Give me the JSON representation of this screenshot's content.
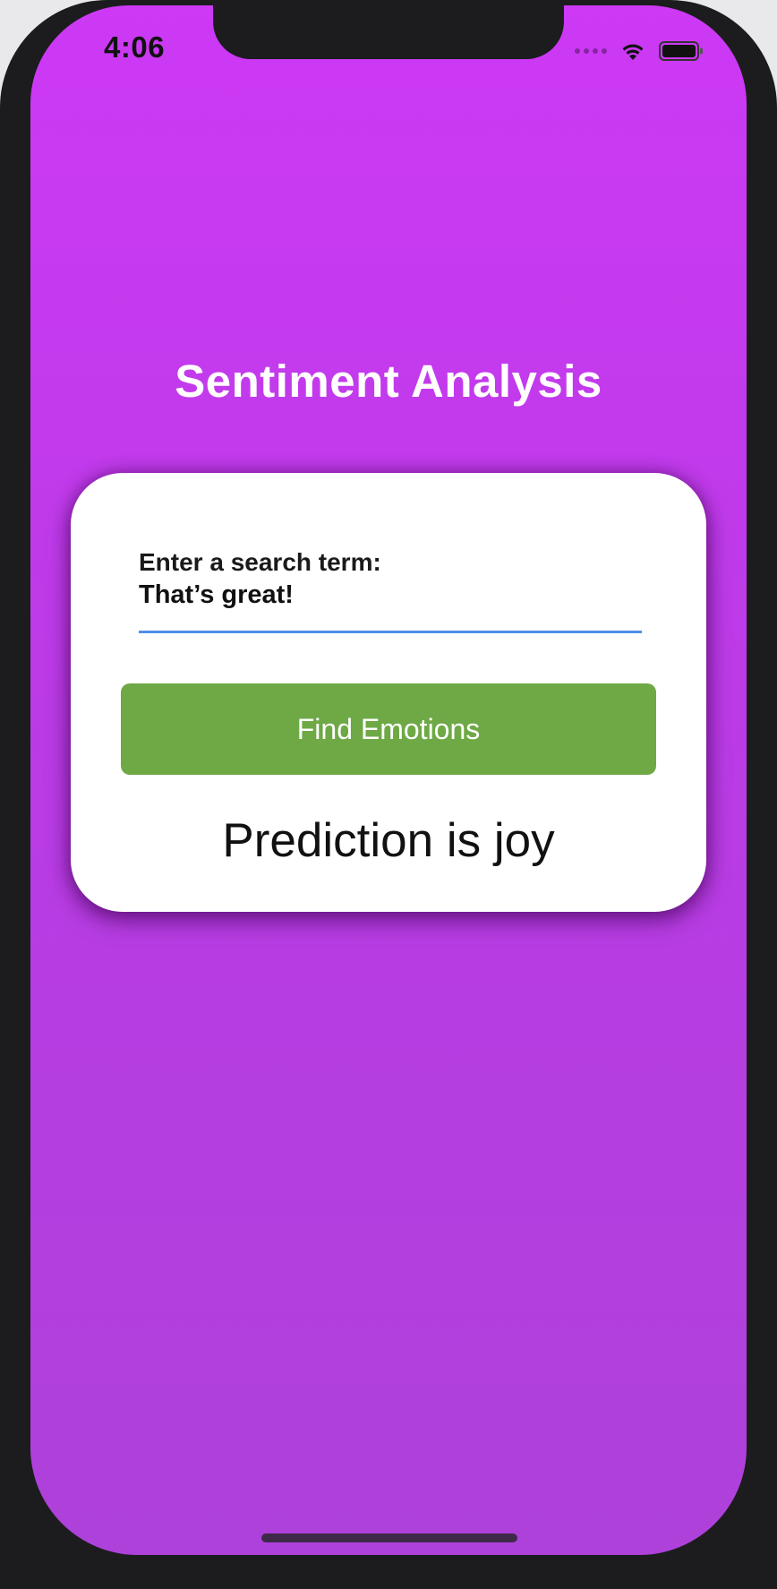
{
  "status_bar": {
    "time": "4:06",
    "icons": [
      "signal-dots-icon",
      "wifi-icon",
      "battery-icon"
    ]
  },
  "app": {
    "title": "Sentiment Analysis"
  },
  "card": {
    "field_label": "Enter a search term:",
    "field_value": "That’s great!",
    "button_label": "Find Emotions",
    "prediction_text": "Prediction is joy"
  },
  "colors": {
    "background_top": "#cd39f5",
    "background_bottom": "#ae41da",
    "button": "#6ea945",
    "input_underline": "#4f8fe8",
    "card": "#ffffff"
  }
}
